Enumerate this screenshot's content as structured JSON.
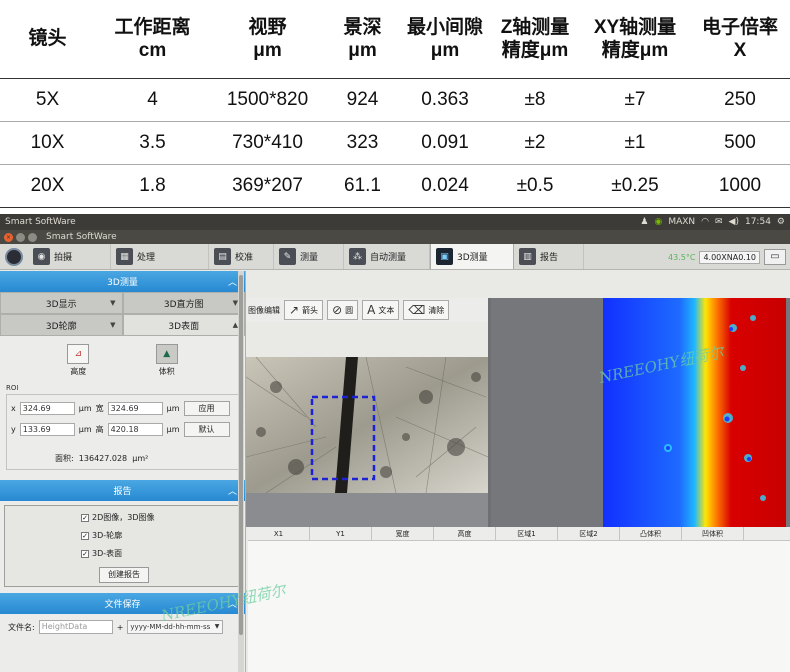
{
  "spec_table": {
    "headers": [
      {
        "line1": "镜头",
        "line2": ""
      },
      {
        "line1": "工作距离",
        "line2": "cm"
      },
      {
        "line1": "视野",
        "line2": "μm"
      },
      {
        "line1": "景深",
        "line2": "μm"
      },
      {
        "line1": "最小间隙",
        "line2": "μm"
      },
      {
        "line1": "Z轴测量",
        "line2": "精度μm"
      },
      {
        "line1": "XY轴测量",
        "line2": "精度μm"
      },
      {
        "line1": "电子倍率",
        "line2": "X"
      }
    ],
    "rows": [
      [
        "5X",
        "4",
        "1500*820",
        "924",
        "0.363",
        "±8",
        "±7",
        "250"
      ],
      [
        "10X",
        "3.5",
        "730*410",
        "323",
        "0.091",
        "±2",
        "±1",
        "500"
      ],
      [
        "20X",
        "1.8",
        "369*207",
        "61.1",
        "0.024",
        "±0.5",
        "±0.25",
        "1000"
      ]
    ]
  },
  "system_bar": {
    "title": "Smart SoftWare",
    "tray_label": "MAXN",
    "time": "17:54"
  },
  "window": {
    "title": "Smart SoftWare"
  },
  "toolbar": {
    "tabs": [
      {
        "label": "拍摄",
        "icon": "camera-icon"
      },
      {
        "label": "处理",
        "icon": "image-process-icon"
      },
      {
        "label": "校准",
        "icon": "ruler-icon"
      },
      {
        "label": "测量",
        "icon": "pencil-icon"
      },
      {
        "label": "自动测量",
        "icon": "auto-measure-icon"
      },
      {
        "label": "3D测量",
        "icon": "3d-icon"
      },
      {
        "label": "报告",
        "icon": "report-icon"
      }
    ],
    "temperature": "43.5°C",
    "model": "4.00XNA0.10"
  },
  "left_panel": {
    "section_3d": "3D测量",
    "seg_3d_display": "3D显示",
    "seg_3d_histogram": "3D直方图",
    "seg_3d_profile": "3D轮廓",
    "seg_3d_surface": "3D表面",
    "tool_height": "高度",
    "tool_volume": "体积",
    "roi_label": "ROI",
    "roi_x_label": "x",
    "roi_x": "324.69",
    "roi_y_label": "y",
    "roi_y": "133.69",
    "roi_w_label": "宽",
    "roi_w": "324.69",
    "roi_h_label": "高",
    "roi_h": "420.18",
    "unit": "μm",
    "apply_btn": "应用",
    "default_btn": "默认",
    "area_label": "面积:",
    "area_value": "136427.028",
    "area_unit": "μm²",
    "section_report": "报告",
    "report_opt1": "2D图像，3D图像",
    "report_opt2": "3D-轮廓",
    "report_opt3": "3D-表面",
    "create_report_btn": "创建报告",
    "section_save": "文件保存",
    "filename_label": "文件名:",
    "filename_placeholder": "HeightData",
    "plus": "+",
    "date_format": "yyyy-MM-dd-hh-mm-ss"
  },
  "image_toolbar": {
    "label": "图像编辑",
    "arrow": "箭头",
    "circle": "圆",
    "text": "文本",
    "clear": "清除"
  },
  "data_table": {
    "columns": [
      "X1",
      "Y1",
      "宽度",
      "高度",
      "区域1",
      "区域2",
      "凸体积",
      "凹体积"
    ]
  },
  "watermarks": [
    "NREEOHY纽荷尔",
    "NREEOHY纽荷尔"
  ],
  "colors": {
    "panel_header": "#2789d2",
    "heat_blue": "#1e3cff",
    "heat_red": "#d80000"
  }
}
